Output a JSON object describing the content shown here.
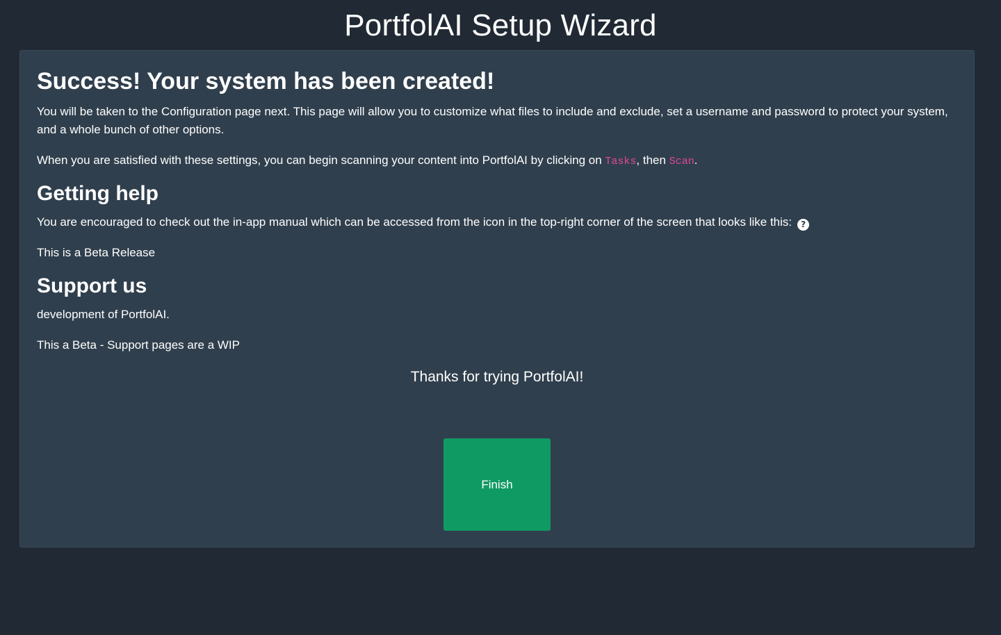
{
  "header": {
    "title": "PortfolAI Setup Wizard"
  },
  "card": {
    "success_heading": "Success! Your system has been created!",
    "config_paragraph": "You will be taken to the Configuration page next. This page will allow you to customize what files to include and exclude, set a username and password to protect your system, and a whole bunch of other options.",
    "scan_paragraph": {
      "prefix": "When you are satisfied with these settings, you can begin scanning your content into PortfolAI by clicking on ",
      "tasks_code": "Tasks",
      "middle": ", then ",
      "scan_code": "Scan",
      "suffix": "."
    },
    "help_heading": "Getting help",
    "help_paragraph": "You are encouraged to check out the in-app manual which can be accessed from the icon in the top-right corner of the screen that looks like this:",
    "help_icon": "question-circle-icon",
    "help_icon_glyph": "?",
    "beta_release": "This is a Beta Release",
    "support_heading": "Support us",
    "support_paragraph": "development of PortfolAI.",
    "support_wip": "This a Beta - Support pages are a WIP",
    "thanks": "Thanks for trying PortfolAI!",
    "finish_button": "Finish"
  },
  "colors": {
    "page_background": "#212a34",
    "card_background": "#303f4d",
    "code_text": "#e0489a",
    "finish_button": "#109a63"
  }
}
